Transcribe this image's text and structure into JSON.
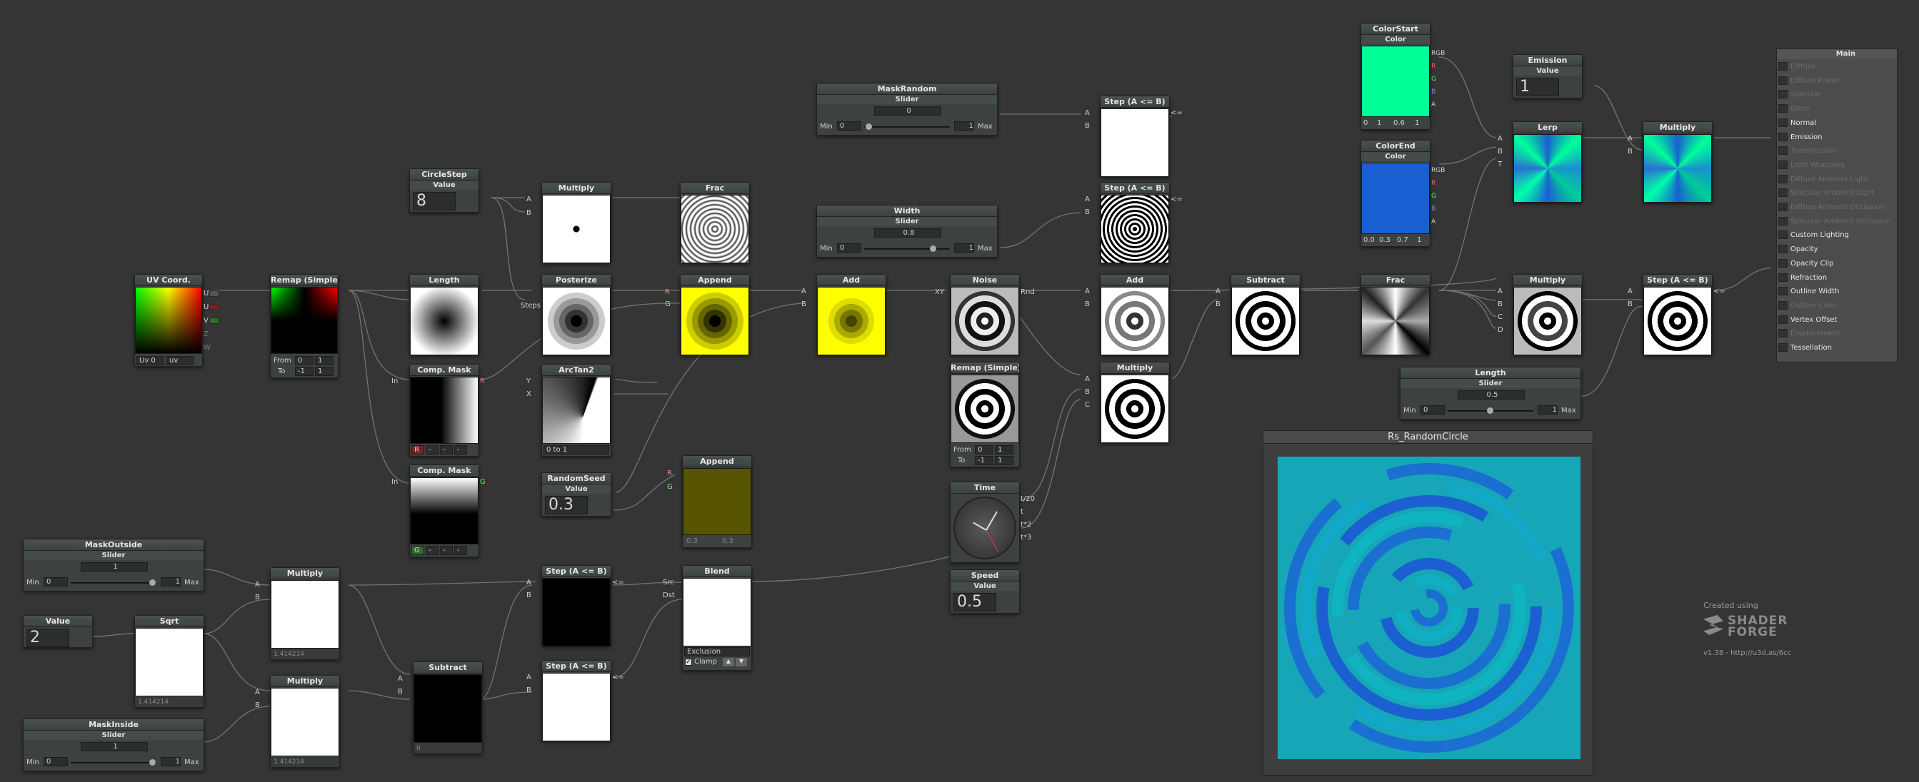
{
  "colors": {
    "accent_green": "#00ff99",
    "accent_blue": "#1a5fd1",
    "yellow": "#ffff00",
    "dark_olive": "#5a5500",
    "panel_bg": "#3d4240",
    "canvas_bg": "#353535"
  },
  "nodes": {
    "uv": {
      "title": "UV Coord.",
      "out": [
        "UV",
        "U",
        "V",
        "Z",
        "W"
      ],
      "f1": "Uv 0",
      "f2": "uv"
    },
    "remap1": {
      "title": "Remap (Simple)",
      "from_label": "From",
      "from": [
        "0",
        "1"
      ],
      "to_label": "To",
      "to": [
        "-1",
        "1"
      ]
    },
    "circlestep": {
      "title": "CircleStep",
      "sub": "Value",
      "val": "8"
    },
    "length": {
      "title": "Length"
    },
    "mul1": {
      "title": "Multiply",
      "pins": [
        "A",
        "B"
      ]
    },
    "frac1": {
      "title": "Frac"
    },
    "posterize": {
      "title": "Posterize",
      "steps": "Steps"
    },
    "append1": {
      "title": "Append",
      "pins": [
        "R",
        "G"
      ]
    },
    "add1": {
      "title": "Add",
      "pins": [
        "A",
        "B"
      ]
    },
    "noise": {
      "title": "Noise",
      "pins": [
        "XY"
      ],
      "out": "Rnd"
    },
    "compmask1": {
      "title": "Comp. Mask",
      "in": "In",
      "out": "R",
      "chan": [
        "R",
        "-",
        "-",
        "-"
      ]
    },
    "compmask2": {
      "title": "Comp. Mask",
      "in": "In",
      "out": "G",
      "chan": [
        "G",
        "-",
        "-",
        "-"
      ]
    },
    "arctan": {
      "title": "ArcTan2",
      "pins": [
        "Y",
        "X"
      ],
      "dropdown": "0 to 1"
    },
    "randomseed": {
      "title": "RandomSeed",
      "sub": "Value",
      "val": "0.3"
    },
    "append2": {
      "title": "Append",
      "pins": [
        "R",
        "G"
      ],
      "f1": "0.3",
      "f2": "0.3"
    },
    "maskrandom": {
      "title": "MaskRandom",
      "sub": "Slider",
      "val": "0",
      "min_label": "Min",
      "min": "0",
      "max": "1",
      "max_label": "Max"
    },
    "width": {
      "title": "Width",
      "sub": "Slider",
      "val": "0.8",
      "min_label": "Min",
      "min": "0",
      "max": "1",
      "max_label": "Max"
    },
    "step1": {
      "title": "Step (A <= B)",
      "pins": [
        "A",
        "B"
      ],
      "out": "<="
    },
    "step2": {
      "title": "Step (A <= B)",
      "pins": [
        "A",
        "B"
      ],
      "out": "<="
    },
    "add2": {
      "title": "Add",
      "pins": [
        "A",
        "B"
      ]
    },
    "remap2": {
      "title": "Remap (Simple)",
      "from_label": "From",
      "from": [
        "0",
        "1"
      ],
      "to_label": "To",
      "to": [
        "-1",
        "1"
      ]
    },
    "mul2": {
      "title": "Multiply",
      "pins": [
        "A",
        "B",
        "C"
      ]
    },
    "time": {
      "title": "Time",
      "out": [
        "t/20",
        "t",
        "t*2",
        "t*3"
      ]
    },
    "speed": {
      "title": "Speed",
      "sub": "Value",
      "val": "0.5"
    },
    "subtract1": {
      "title": "Subtract",
      "pins": [
        "A",
        "B"
      ]
    },
    "frac2": {
      "title": "Frac"
    },
    "colorstart": {
      "title": "ColorStart",
      "sub": "Color",
      "out": [
        "RGB",
        "R",
        "G",
        "B",
        "A"
      ],
      "vals": [
        "0",
        "1",
        "0.6",
        "1"
      ]
    },
    "colorend": {
      "title": "ColorEnd",
      "sub": "Color",
      "out": [
        "RGB",
        "R",
        "G",
        "B",
        "A"
      ],
      "vals": [
        "0.0",
        "0.3",
        "0.7",
        "1"
      ]
    },
    "emission": {
      "title": "Emission",
      "sub": "Value",
      "val": "1"
    },
    "lerp": {
      "title": "Lerp",
      "pins": [
        "A",
        "B",
        "T"
      ]
    },
    "mul3": {
      "title": "Multiply",
      "pins": [
        "A",
        "B"
      ]
    },
    "mul4": {
      "title": "Multiply",
      "pins": [
        "A",
        "B",
        "C",
        "D"
      ]
    },
    "step3": {
      "title": "Step (A <= B)",
      "pins": [
        "A",
        "B"
      ],
      "out": "<="
    },
    "lengthslider": {
      "title": "Length",
      "sub": "Slider",
      "val": "0.5",
      "min_label": "Min",
      "min": "0",
      "max": "1",
      "max_label": "Max"
    },
    "maskoutside": {
      "title": "MaskOutside",
      "sub": "Slider",
      "val": "1",
      "min_label": "Min",
      "min": "0",
      "max": "1",
      "max_label": "Max"
    },
    "value2": {
      "title": "Value",
      "val": "2"
    },
    "sqrt": {
      "title": "Sqrt",
      "foot": "1.414214"
    },
    "mul5": {
      "title": "Multiply",
      "pins": [
        "A",
        "B"
      ],
      "foot": "1.414214"
    },
    "mul6": {
      "title": "Multiply",
      "pins": [
        "A",
        "B"
      ],
      "foot": "1.414214"
    },
    "maskinside": {
      "title": "MaskInside",
      "sub": "Slider",
      "val": "1",
      "min_label": "Min",
      "min": "0",
      "max": "1",
      "max_label": "Max"
    },
    "subtract2": {
      "title": "Subtract",
      "pins": [
        "A",
        "B"
      ],
      "foot": "0"
    },
    "step4": {
      "title": "Step (A <= B)",
      "pins": [
        "A",
        "B"
      ],
      "out": "<="
    },
    "step5": {
      "title": "Step (A <= B)",
      "pins": [
        "A",
        "B"
      ],
      "out": "<="
    },
    "blend": {
      "title": "Blend",
      "pins": [
        "Src",
        "Dst"
      ],
      "mode": "Exclusion",
      "clamp": "Clamp"
    }
  },
  "preview": {
    "title": "Rs_RandomCircle"
  },
  "main": {
    "title": "Main",
    "items": [
      "Diffuse",
      "Diffuse Power",
      "Specular",
      "Gloss",
      "Normal",
      "Emission",
      "Transmission",
      "Light Wrapping",
      "Diffuse Ambient Light",
      "Specular Ambient Light",
      "Diffuse Ambient Occlusion",
      "Specular Ambient Occlusion",
      "Custom Lighting",
      "Opacity",
      "Opacity Clip",
      "Refraction",
      "Outline Width",
      "Outline Color",
      "Vertex Offset",
      "Displacement",
      "Tessellation"
    ],
    "active": [
      4,
      5,
      12,
      13,
      14,
      15,
      16,
      18,
      20
    ]
  },
  "branding": {
    "created": "Created using",
    "logo1": "SHADER",
    "logo2": "FORGE",
    "version": "v1.38 - http://u3d.as/6cc"
  }
}
